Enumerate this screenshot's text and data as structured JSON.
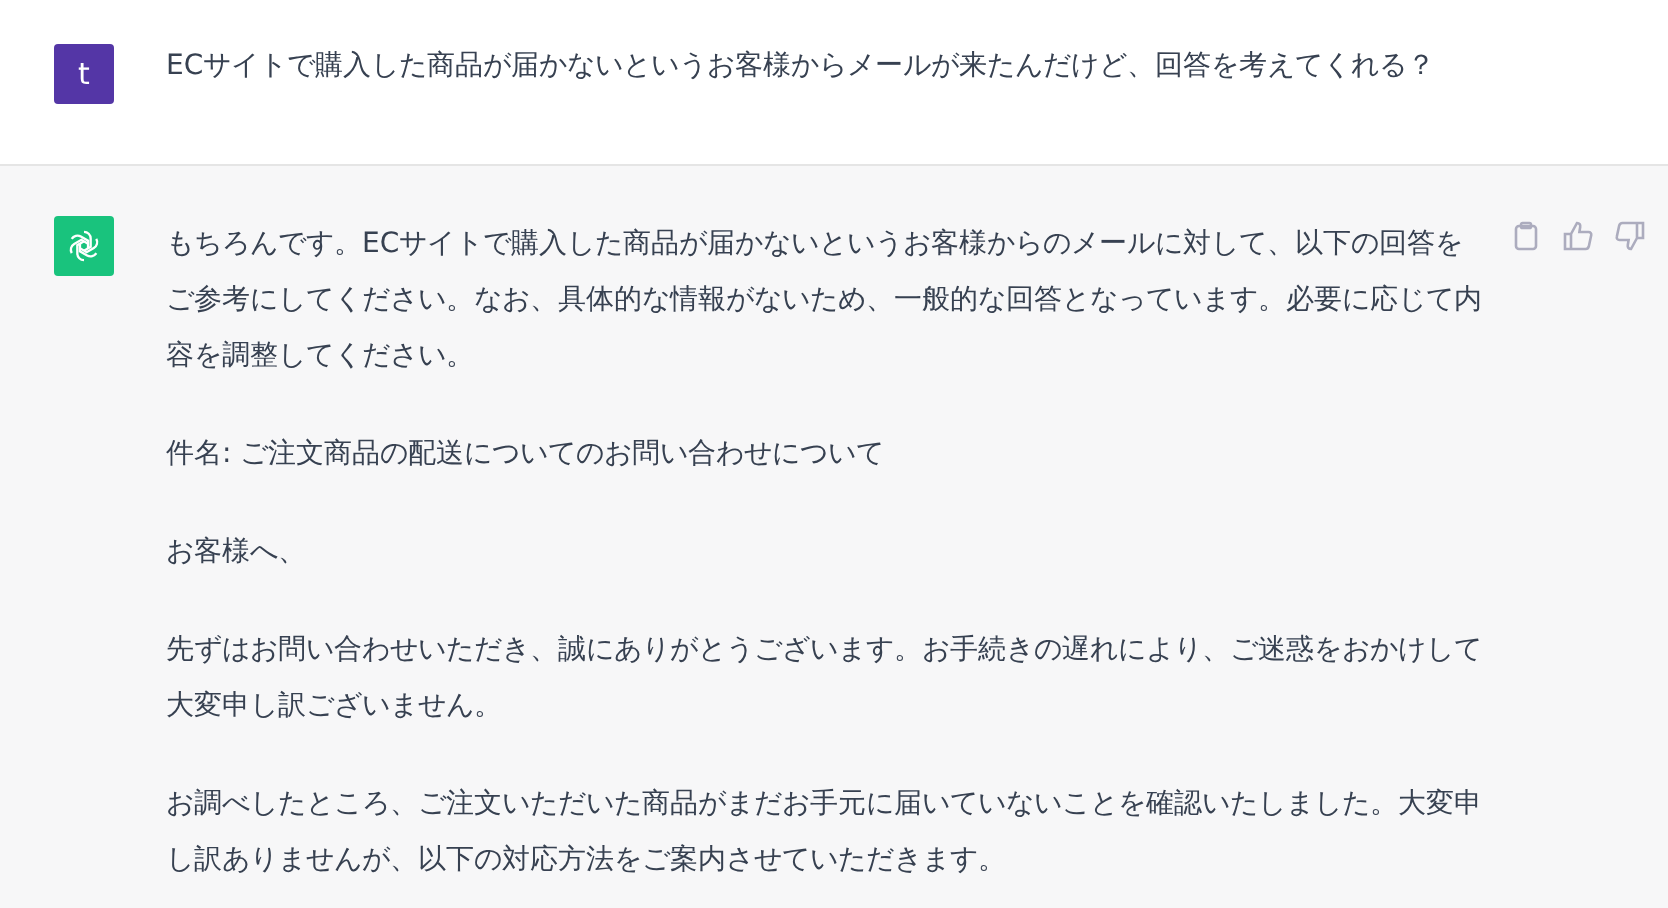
{
  "messages": [
    {
      "kind": "user",
      "avatar": "t",
      "paragraphs": [
        "ECサイトで購入した商品が届かないというお客様からメールが来たんだけど、回答を考えてくれる？"
      ]
    },
    {
      "kind": "assistant",
      "paragraphs": [
        "もちろんです。ECサイトで購入した商品が届かないというお客様からのメールに対して、以下の回答をご参考にしてください。なお、具体的な情報がないため、一般的な回答となっています。必要に応じて内容を調整してください。",
        "件名: ご注文商品の配送についてのお問い合わせについて",
        "お客様へ、",
        "先ずはお問い合わせいただき、誠にありがとうございます。お手続きの遅れにより、ご迷惑をおかけして大変申し訳ございません。",
        "お調べしたところ、ご注文いただいた商品がまだお手元に届いていないことを確認いたしました。大変申し訳ありませんが、以下の対応方法をご案内させていただきます。"
      ]
    }
  ]
}
